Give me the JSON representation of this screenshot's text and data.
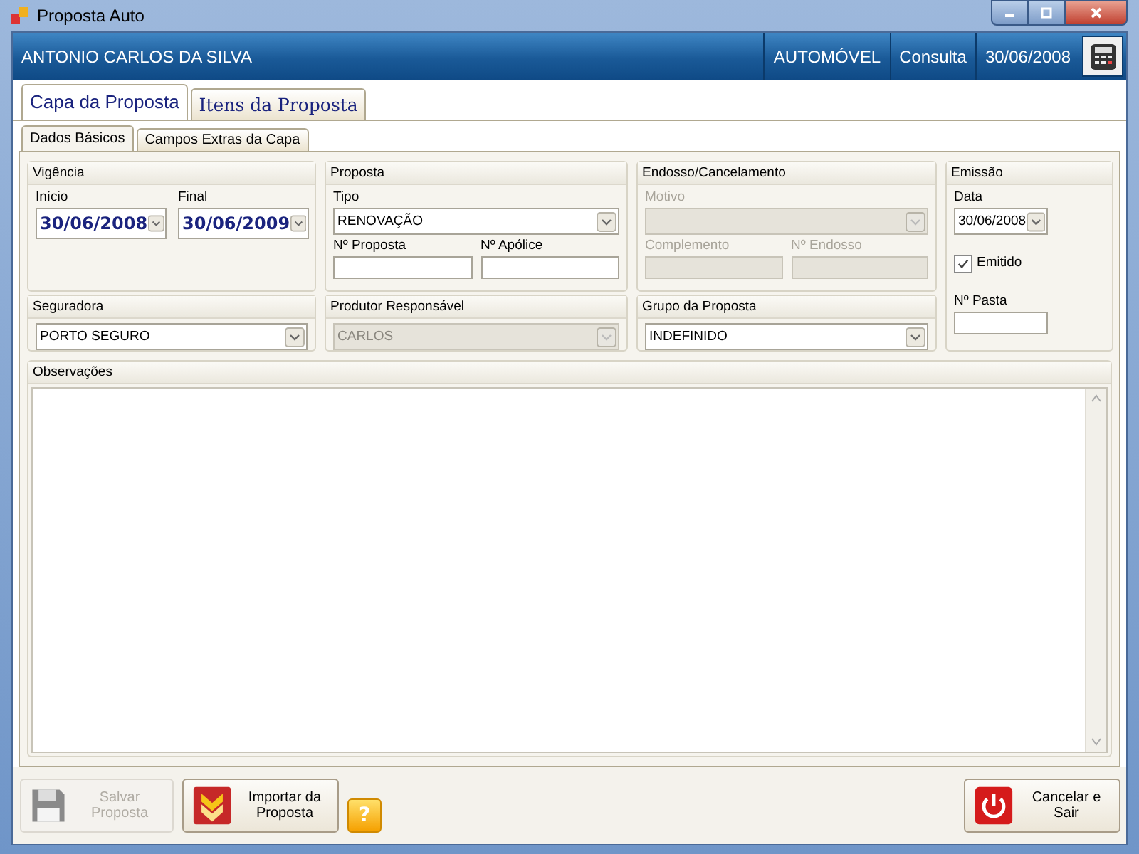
{
  "window": {
    "title": "Proposta Auto"
  },
  "header": {
    "client": "ANTONIO CARLOS DA SILVA",
    "cells": [
      "AUTOMÓVEL",
      "Consulta",
      "30/06/2008"
    ]
  },
  "tabs": [
    {
      "label": "Capa da Proposta",
      "selected": true
    },
    {
      "label": "Itens da Proposta",
      "selected": false
    }
  ],
  "subtabs": [
    {
      "label": "Dados Básicos",
      "selected": true
    },
    {
      "label": "Campos Extras da Capa",
      "selected": false
    }
  ],
  "groups": [
    {
      "title": "Vigência",
      "rows": [
        [
          {
            "kind": "bigdate",
            "label": "Início",
            "value": "30/06/2008",
            "disabled": false
          },
          {
            "kind": "bigdate",
            "label": "Final",
            "value": "30/06/2009",
            "disabled": false
          }
        ]
      ]
    },
    {
      "title": "Proposta",
      "rows": [
        [
          {
            "kind": "combo",
            "label": "Tipo",
            "value": "RENOVAÇÃO",
            "disabled": false
          }
        ],
        [
          {
            "kind": "text",
            "label": "Nº Proposta",
            "disabled": false
          },
          {
            "kind": "text",
            "label": "Nº Apólice",
            "disabled": false
          }
        ]
      ]
    },
    {
      "title": "Endosso/Cancelamento",
      "rows": [
        [
          {
            "kind": "combo",
            "label": "Motivo",
            "disabled": true
          }
        ],
        [
          {
            "kind": "text",
            "label": "Complemento",
            "disabled": true
          },
          {
            "kind": "text",
            "label": "Nº Endosso",
            "disabled": true
          }
        ]
      ]
    },
    {
      "title": "Emissão",
      "rows": [
        [
          {
            "kind": "date",
            "label": "Data",
            "value": "30/06/2008",
            "disabled": false
          }
        ],
        [
          {
            "kind": "checkbox",
            "label": "Emitido",
            "checked": true,
            "disabled": false
          }
        ],
        [
          {
            "kind": "text",
            "label": "Nº Pasta",
            "disabled": false
          }
        ]
      ]
    },
    {
      "title": "Seguradora",
      "rows": [
        [
          {
            "kind": "combo",
            "value": "PORTO SEGURO",
            "disabled": false
          }
        ]
      ]
    },
    {
      "title": "Produtor Responsável",
      "rows": [
        [
          {
            "kind": "combo",
            "value": "CARLOS",
            "disabled": true
          }
        ]
      ]
    },
    {
      "title": "Grupo da Proposta",
      "rows": [
        [
          {
            "kind": "combo",
            "value": "INDEFINIDO",
            "disabled": false
          }
        ]
      ]
    }
  ],
  "notes": {
    "title": "Observações"
  },
  "buttons": [
    {
      "kind": "save",
      "label": "Salvar Proposta",
      "disabled": true
    },
    {
      "kind": "import",
      "label": "Importar da Proposta",
      "disabled": false
    },
    {
      "kind": "help",
      "label": "?",
      "disabled": false
    },
    {
      "kind": "exit",
      "label": "Cancelar e Sair",
      "disabled": false
    }
  ]
}
